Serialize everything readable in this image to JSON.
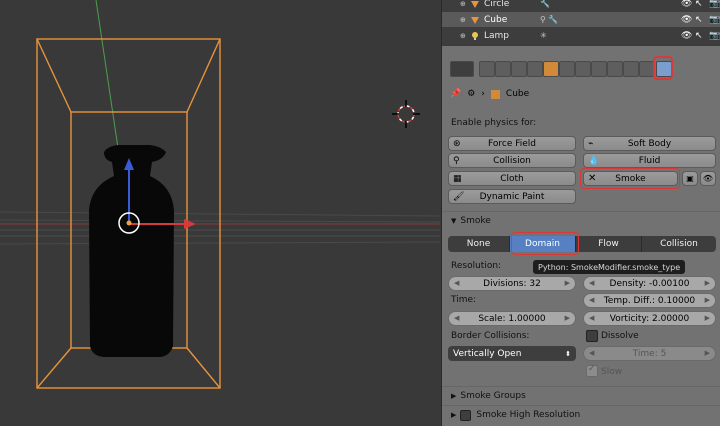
{
  "outliner": {
    "rows": [
      {
        "name": "Circle",
        "selected": false
      },
      {
        "name": "Cube",
        "selected": true
      },
      {
        "name": "Lamp",
        "selected": false
      }
    ]
  },
  "breadcrumb": {
    "object": "Cube"
  },
  "physics": {
    "enable_label": "Enable physics for:",
    "buttons": {
      "force_field": "Force Field",
      "soft_body": "Soft Body",
      "collision": "Collision",
      "fluid": "Fluid",
      "cloth": "Cloth",
      "smoke": "Smoke",
      "dynamic_paint": "Dynamic Paint"
    }
  },
  "smoke_panel": {
    "title": "Smoke",
    "types": [
      "None",
      "Domain",
      "Flow",
      "Collision"
    ],
    "active_type": "Domain",
    "tooltip": "Python: SmokeModifier.smoke_type",
    "resolution_label": "Resolution:",
    "divisions": "Divisions: 32",
    "density": "Density: -0.00100",
    "temp_diff": "Temp. Diff.: 0.10000",
    "time_label": "Time:",
    "scale": "Scale: 1.00000",
    "vorticity": "Vorticity: 2.00000",
    "border_label": "Border Collisions:",
    "border_value": "Vertically Open",
    "dissolve": "Dissolve",
    "time_value": "Time: 5",
    "slow": "Slow"
  },
  "panels": {
    "smoke_groups": "Smoke Groups",
    "smoke_high_res": "Smoke High Resolution"
  },
  "colors": {
    "accent": "#5680c2",
    "highlight": "#d63a3a",
    "selection": "#f0a040"
  }
}
